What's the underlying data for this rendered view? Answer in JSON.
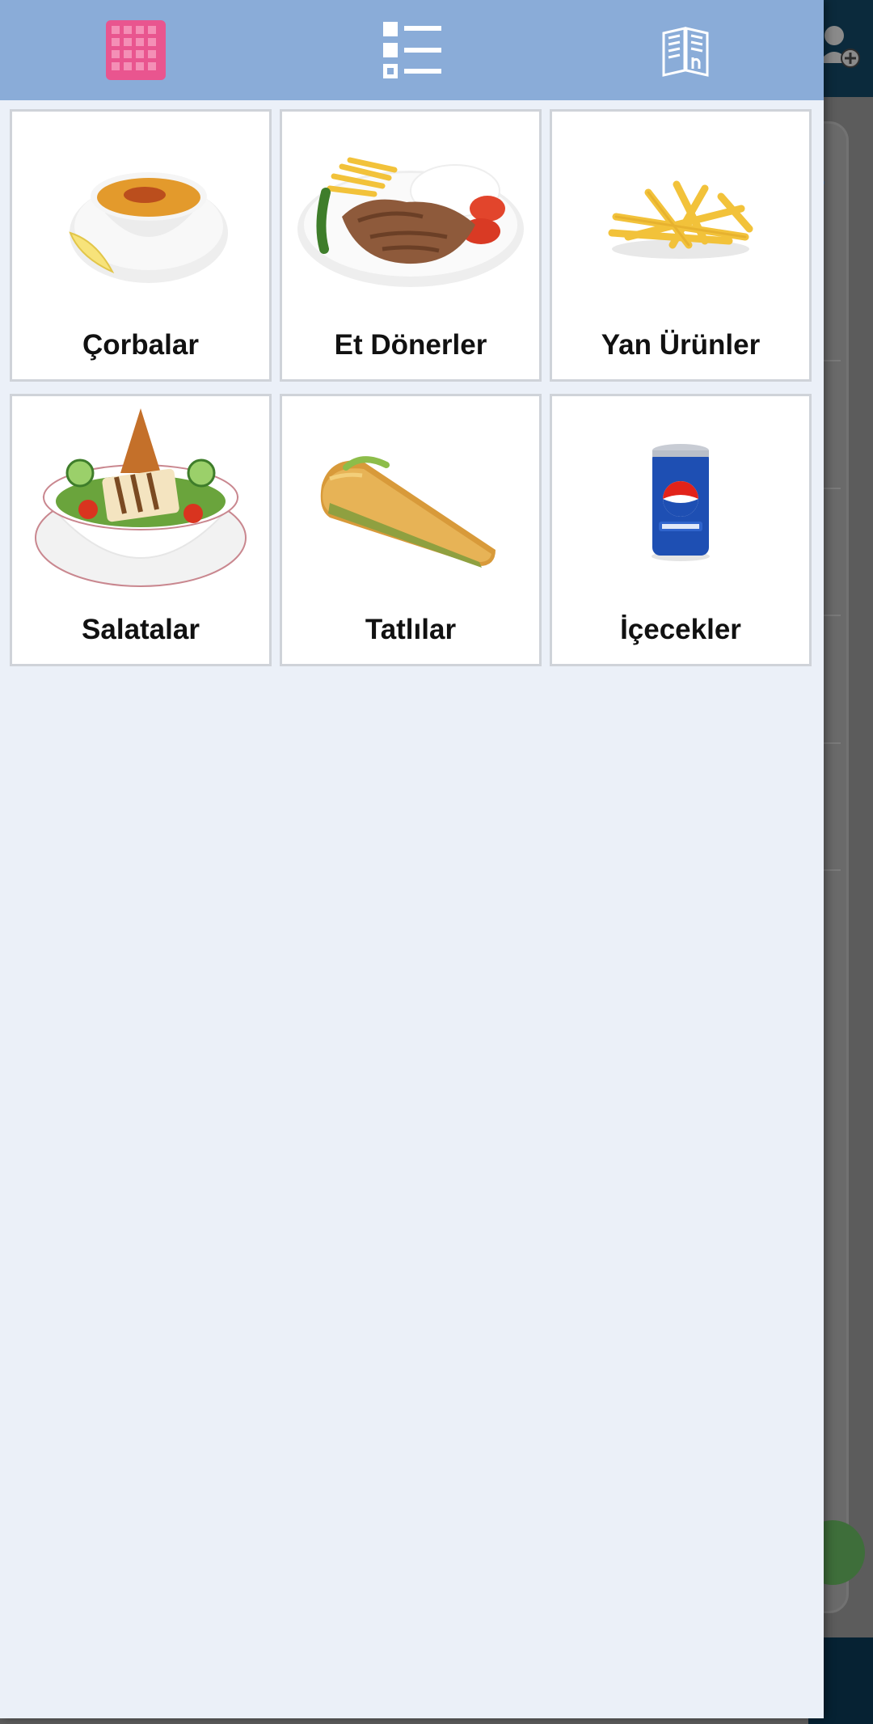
{
  "toolbar": {
    "buttons": [
      {
        "name": "grid-view",
        "icon": "grid-icon",
        "active": true
      },
      {
        "name": "list-view",
        "icon": "list-icon",
        "active": false
      },
      {
        "name": "menu-view",
        "icon": "menu-book-icon",
        "active": false
      }
    ],
    "colors": {
      "bar": "#8aacd8",
      "active": "#e9558f",
      "inactive": "#ffffff"
    }
  },
  "categories": [
    {
      "label": "Çorbalar",
      "image": "lentil-soup-image"
    },
    {
      "label": "Et Dönerler",
      "image": "doner-plate-image"
    },
    {
      "label": "Yan Ürünler",
      "image": "french-fries-image"
    },
    {
      "label": "Salatalar",
      "image": "salad-bowl-image"
    },
    {
      "label": "Tatlılar",
      "image": "baklava-image"
    },
    {
      "label": "İçecekler",
      "image": "pepsi-can-image"
    }
  ],
  "colors": {
    "drawer_bg": "#ebf0f8",
    "card_bg": "#ffffff",
    "card_border": "#cfd3d9"
  }
}
